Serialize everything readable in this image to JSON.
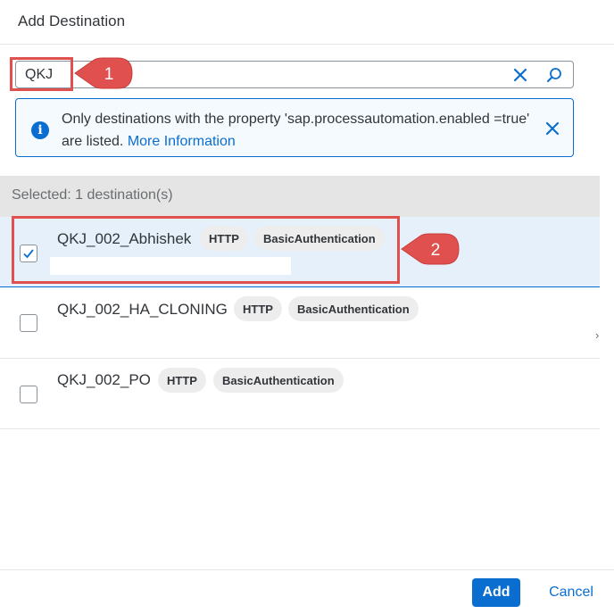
{
  "dialog": {
    "title": "Add Destination"
  },
  "search": {
    "value": "QKJ",
    "clear_icon": "close-icon",
    "search_icon": "search-icon"
  },
  "info_strip": {
    "message": "Only destinations with the property 'sap.processautomation.enabled =true' are listed.",
    "link": "More Information",
    "icon": "info-icon",
    "close_icon": "close-icon"
  },
  "selection": {
    "summary": "Selected: 1 destination(s)"
  },
  "destinations": [
    {
      "name": "QKJ_002_Abhishek",
      "tags": [
        "HTTP",
        "BasicAuthentication"
      ],
      "checked": true
    },
    {
      "name": "QKJ_002_HA_CLONING",
      "tags": [
        "HTTP",
        "BasicAuthentication"
      ],
      "checked": false
    },
    {
      "name": "QKJ_002_PO",
      "tags": [
        "HTTP",
        "BasicAuthentication"
      ],
      "checked": false
    }
  ],
  "callouts": [
    {
      "number": "1"
    },
    {
      "number": "2"
    }
  ],
  "footer": {
    "add_label": "Add",
    "cancel_label": "Cancel"
  },
  "colors": {
    "accent": "#0a6ed1",
    "callout": "#e0504e",
    "selected_row": "#e5f0fa",
    "header_bar": "#e5e5e5"
  }
}
